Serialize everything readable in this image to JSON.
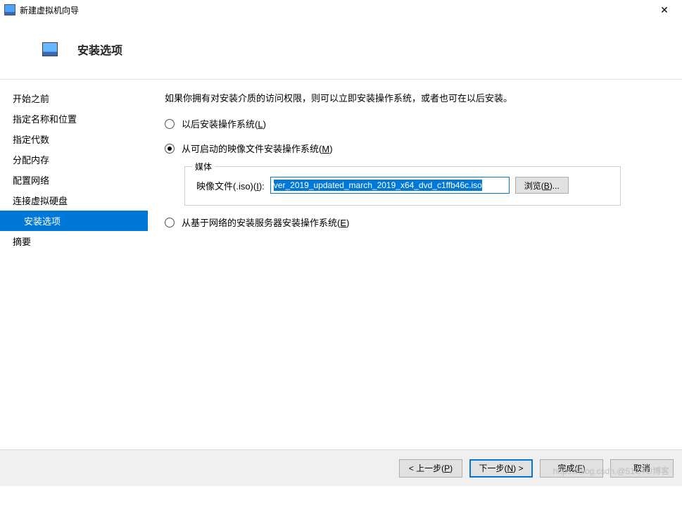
{
  "window": {
    "title": "新建虚拟机向导"
  },
  "header": {
    "heading": "安装选项"
  },
  "sidebar": {
    "items": [
      {
        "label": "开始之前"
      },
      {
        "label": "指定名称和位置"
      },
      {
        "label": "指定代数"
      },
      {
        "label": "分配内存"
      },
      {
        "label": "配置网络"
      },
      {
        "label": "连接虚拟硬盘"
      },
      {
        "label": "安装选项"
      },
      {
        "label": "摘要"
      }
    ],
    "active_index": 6
  },
  "main": {
    "intro": "如果你拥有对安装介质的访问权限，则可以立即安装操作系统，或者也可在以后安装。",
    "options": [
      {
        "label_pre": "以后安装操作系统(",
        "hk": "L",
        "label_post": ")"
      },
      {
        "label_pre": "从可启动的映像文件安装操作系统(",
        "hk": "M",
        "label_post": ")"
      },
      {
        "label_pre": "从基于网络的安装服务器安装操作系统(",
        "hk": "E",
        "label_post": ")"
      }
    ],
    "selected_option": 1,
    "media": {
      "legend": "媒体",
      "iso_label_pre": "映像文件(.iso)(",
      "iso_hk": "I",
      "iso_label_post": "):",
      "iso_value": "ver_2019_updated_march_2019_x64_dvd_c1ffb46c.iso",
      "browse_pre": "浏览(",
      "browse_hk": "B",
      "browse_post": ")..."
    }
  },
  "footer": {
    "prev_pre": "< 上一步(",
    "prev_hk": "P",
    "prev_post": ")",
    "next_pre": "下一步(",
    "next_hk": "N",
    "next_post": ") >",
    "finish_pre": "完成(",
    "finish_hk": "F",
    "finish_post": ")",
    "cancel": "取消"
  },
  "watermark": "https://blog.csdn.@51CTO博客"
}
